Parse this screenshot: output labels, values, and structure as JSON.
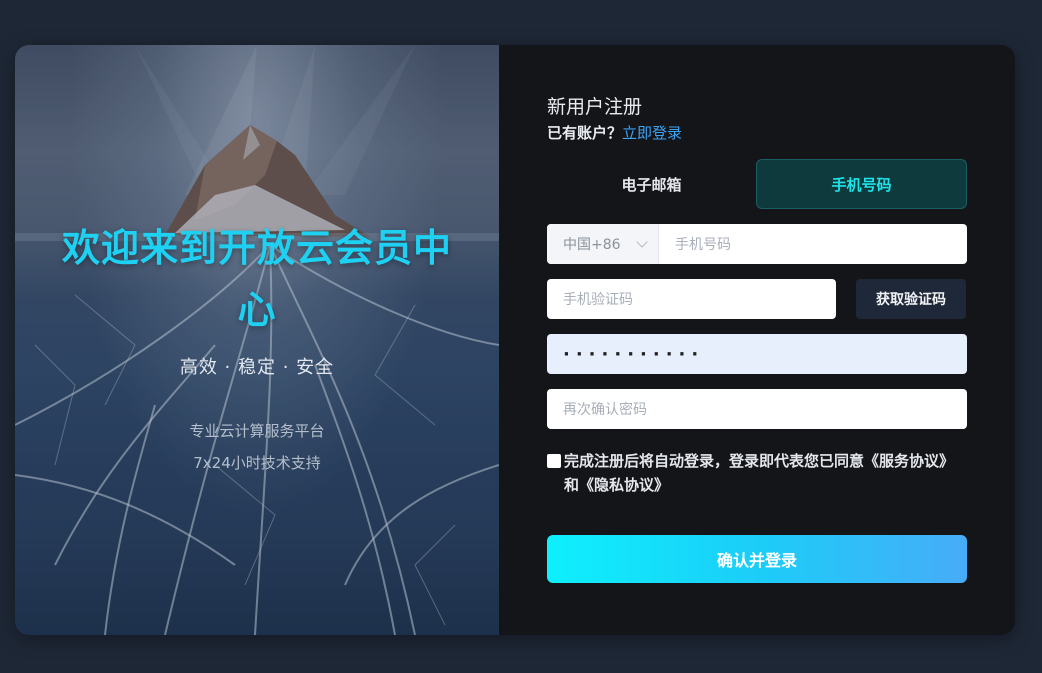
{
  "hero": {
    "title": "欢迎来到开放云会员中心",
    "tagline": "高效 · 稳定 · 安全",
    "desc_line1": "专业云计算服务平台",
    "desc_line2": "7x24小时技术支持"
  },
  "form": {
    "title": "新用户注册",
    "has_account": "已有账户？",
    "login_link": "立即登录",
    "tabs": [
      {
        "label": "电子邮箱",
        "active": false
      },
      {
        "label": "手机号码",
        "active": true
      }
    ],
    "country_code": "中国+86",
    "phone_placeholder": "手机号码",
    "code_placeholder": "手机验证码",
    "get_code_label": "获取验证码",
    "password_value": "···········",
    "confirm_placeholder": "再次确认密码",
    "agreement": "完成注册后将自动登录，登录即代表您已同意《服务协议》和《隐私协议》",
    "submit_label": "确认并登录"
  },
  "colors": {
    "accent": "#1ed1f3",
    "link": "#3ba4f5",
    "panel_bg": "#141519",
    "page_bg": "#1e2736"
  }
}
